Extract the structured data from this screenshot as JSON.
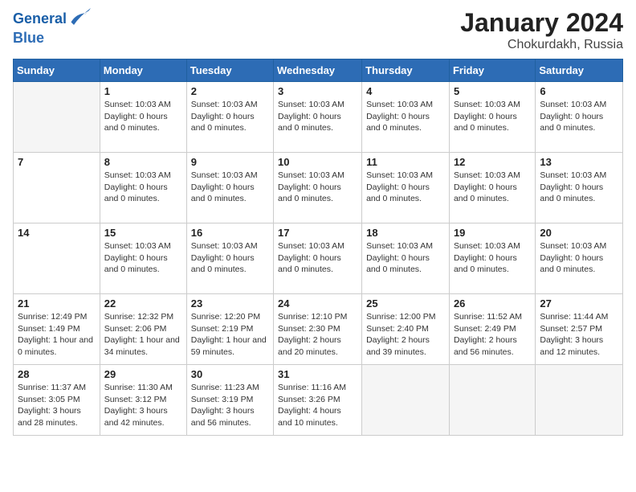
{
  "header": {
    "logo_line1": "General",
    "logo_line2": "Blue",
    "title": "January 2024",
    "subtitle": "Chokurdakh, Russia"
  },
  "weekdays": [
    "Sunday",
    "Monday",
    "Tuesday",
    "Wednesday",
    "Thursday",
    "Friday",
    "Saturday"
  ],
  "weeks": [
    [
      {
        "day": "",
        "info": ""
      },
      {
        "day": "1",
        "info": "Sunset: 10:03 AM\nDaylight: 0 hours and 0 minutes."
      },
      {
        "day": "2",
        "info": "Sunset: 10:03 AM\nDaylight: 0 hours and 0 minutes."
      },
      {
        "day": "3",
        "info": "Sunset: 10:03 AM\nDaylight: 0 hours and 0 minutes."
      },
      {
        "day": "4",
        "info": "Sunset: 10:03 AM\nDaylight: 0 hours and 0 minutes."
      },
      {
        "day": "5",
        "info": "Sunset: 10:03 AM\nDaylight: 0 hours and 0 minutes."
      },
      {
        "day": "6",
        "info": "Sunset: 10:03 AM\nDaylight: 0 hours and 0 minutes."
      }
    ],
    [
      {
        "day": "7",
        "info": ""
      },
      {
        "day": "8",
        "info": "Sunset: 10:03 AM\nDaylight: 0 hours and 0 minutes."
      },
      {
        "day": "9",
        "info": "Sunset: 10:03 AM\nDaylight: 0 hours and 0 minutes."
      },
      {
        "day": "10",
        "info": "Sunset: 10:03 AM\nDaylight: 0 hours and 0 minutes."
      },
      {
        "day": "11",
        "info": "Sunset: 10:03 AM\nDaylight: 0 hours and 0 minutes."
      },
      {
        "day": "12",
        "info": "Sunset: 10:03 AM\nDaylight: 0 hours and 0 minutes."
      },
      {
        "day": "13",
        "info": "Sunset: 10:03 AM\nDaylight: 0 hours and 0 minutes."
      }
    ],
    [
      {
        "day": "14",
        "info": ""
      },
      {
        "day": "15",
        "info": "Sunset: 10:03 AM\nDaylight: 0 hours and 0 minutes."
      },
      {
        "day": "16",
        "info": "Sunset: 10:03 AM\nDaylight: 0 hours and 0 minutes."
      },
      {
        "day": "17",
        "info": "Sunset: 10:03 AM\nDaylight: 0 hours and 0 minutes."
      },
      {
        "day": "18",
        "info": "Sunset: 10:03 AM\nDaylight: 0 hours and 0 minutes."
      },
      {
        "day": "19",
        "info": "Sunset: 10:03 AM\nDaylight: 0 hours and 0 minutes."
      },
      {
        "day": "20",
        "info": "Sunset: 10:03 AM\nDaylight: 0 hours and 0 minutes."
      }
    ],
    [
      {
        "day": "21",
        "info": "Sunrise: 12:49 PM\nSunset: 1:49 PM\nDaylight: 1 hour and 0 minutes."
      },
      {
        "day": "22",
        "info": "Sunrise: 12:32 PM\nSunset: 2:06 PM\nDaylight: 1 hour and 34 minutes."
      },
      {
        "day": "23",
        "info": "Sunrise: 12:20 PM\nSunset: 2:19 PM\nDaylight: 1 hour and 59 minutes."
      },
      {
        "day": "24",
        "info": "Sunrise: 12:10 PM\nSunset: 2:30 PM\nDaylight: 2 hours and 20 minutes."
      },
      {
        "day": "25",
        "info": "Sunrise: 12:00 PM\nSunset: 2:40 PM\nDaylight: 2 hours and 39 minutes."
      },
      {
        "day": "26",
        "info": "Sunrise: 11:52 AM\nSunset: 2:49 PM\nDaylight: 2 hours and 56 minutes."
      },
      {
        "day": "27",
        "info": "Sunrise: 11:44 AM\nSunset: 2:57 PM\nDaylight: 3 hours and 12 minutes."
      }
    ],
    [
      {
        "day": "28",
        "info": "Sunrise: 11:37 AM\nSunset: 3:05 PM\nDaylight: 3 hours and 28 minutes."
      },
      {
        "day": "29",
        "info": "Sunrise: 11:30 AM\nSunset: 3:12 PM\nDaylight: 3 hours and 42 minutes."
      },
      {
        "day": "30",
        "info": "Sunrise: 11:23 AM\nSunset: 3:19 PM\nDaylight: 3 hours and 56 minutes."
      },
      {
        "day": "31",
        "info": "Sunrise: 11:16 AM\nSunset: 3:26 PM\nDaylight: 4 hours and 10 minutes."
      },
      {
        "day": "",
        "info": ""
      },
      {
        "day": "",
        "info": ""
      },
      {
        "day": "",
        "info": ""
      }
    ]
  ]
}
